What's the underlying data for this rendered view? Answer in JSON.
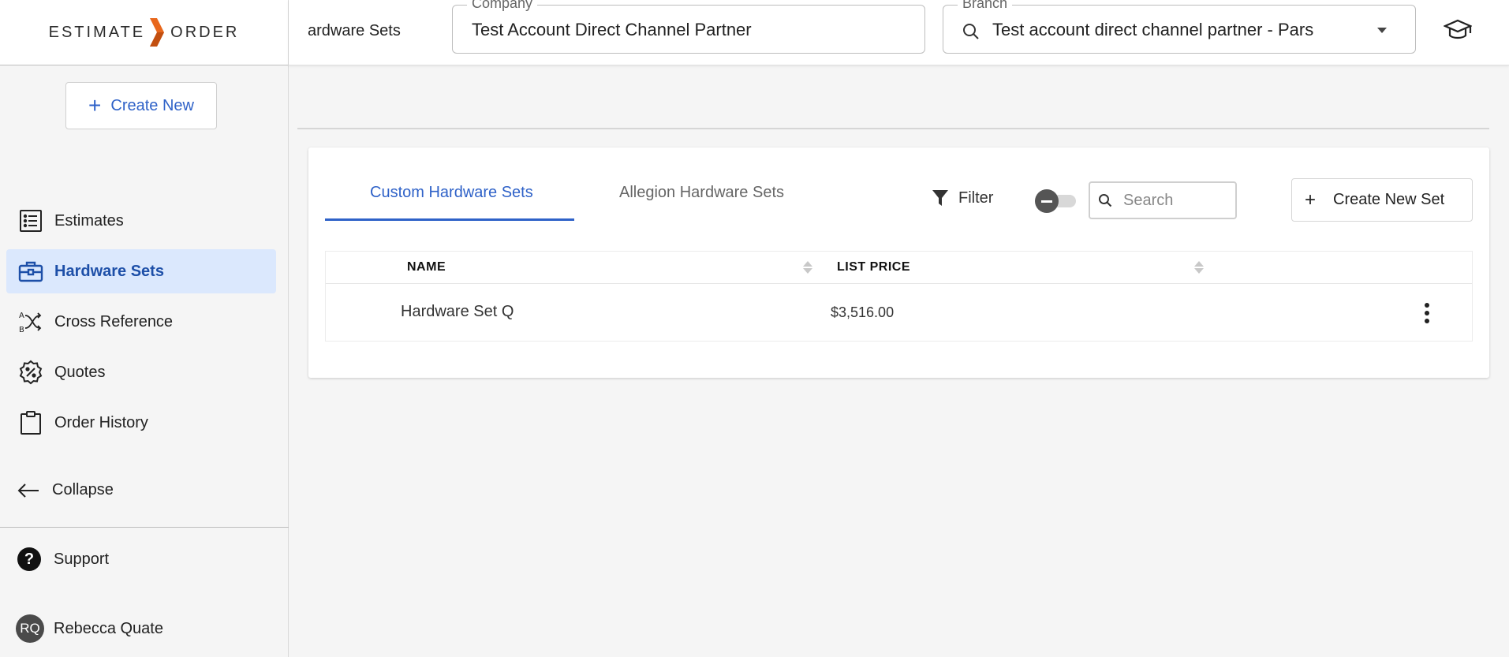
{
  "app": {
    "logo_left": "ESTIMATE",
    "logo_right": "ORDER",
    "brand_color": "#e8671c"
  },
  "sidebar": {
    "create_new_label": "Create New",
    "items": [
      {
        "label": "Estimates",
        "icon": "list-icon",
        "active": false
      },
      {
        "label": "Hardware Sets",
        "icon": "toolbox-icon",
        "active": true
      },
      {
        "label": "Cross Reference",
        "icon": "cross-reference-icon",
        "active": false
      },
      {
        "label": "Quotes",
        "icon": "discount-badge-icon",
        "active": false
      },
      {
        "label": "Order History",
        "icon": "clipboard-icon",
        "active": false
      }
    ],
    "collapse_label": "Collapse",
    "support_label": "Support",
    "user": {
      "initials": "RQ",
      "name": "Rebecca Quate"
    }
  },
  "topbar": {
    "breadcrumb": "ardware Sets",
    "company": {
      "legend": "Company",
      "value": "Test Account Direct Channel Partner"
    },
    "branch": {
      "legend": "Branch",
      "value": "Test account direct channel partner - Pars"
    }
  },
  "main": {
    "tabs": [
      {
        "label": "Custom Hardware Sets",
        "active": true
      },
      {
        "label": "Allegion Hardware Sets",
        "active": false
      }
    ],
    "filter_label": "Filter",
    "search_placeholder": "Search",
    "create_set_label": "Create New Set",
    "table": {
      "columns": [
        "NAME",
        "LIST PRICE"
      ],
      "rows": [
        {
          "name": "Hardware Set Q",
          "list_price": "$3,516.00"
        }
      ]
    }
  },
  "colors": {
    "accent": "#2f62c8",
    "active_nav_bg": "#dbe8fd"
  }
}
